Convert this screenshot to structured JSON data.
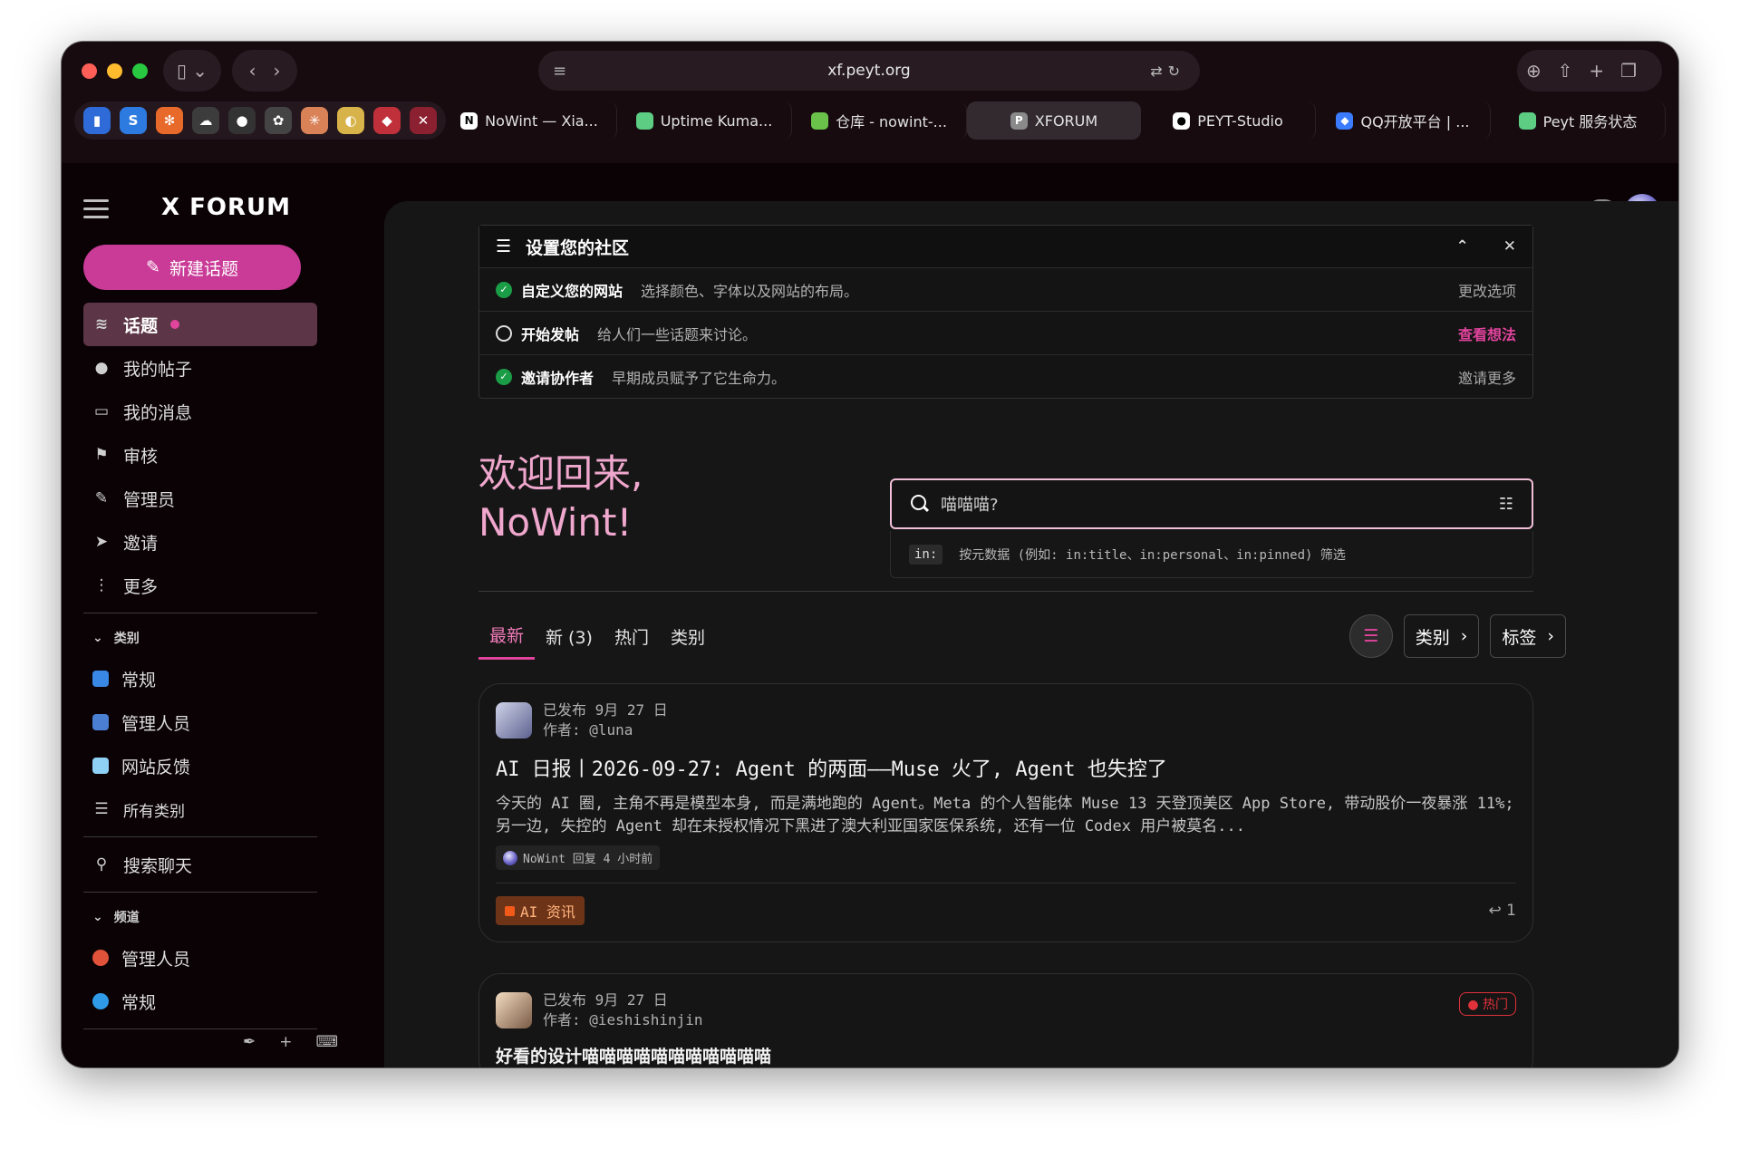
{
  "browser": {
    "url": "xf.peyt.org",
    "pinned": [
      {
        "icon": "bar-chart-icon",
        "glyph": "▮",
        "color": "#2f6bd8"
      },
      {
        "icon": "app-icon",
        "glyph": "S",
        "color": "#2d7be0"
      },
      {
        "icon": "crab-icon",
        "glyph": "✻",
        "color": "#e86a2a"
      },
      {
        "icon": "cloud-icon",
        "glyph": "☁",
        "color": "#3c3c3c"
      },
      {
        "icon": "github-icon",
        "glyph": "●",
        "color": "#333333"
      },
      {
        "icon": "openai-icon",
        "glyph": "✿",
        "color": "#444444"
      },
      {
        "icon": "claude-icon",
        "glyph": "✳",
        "color": "#d98258"
      },
      {
        "icon": "flag-icon",
        "glyph": "◐",
        "color": "#d7b34a"
      },
      {
        "icon": "gem-icon",
        "glyph": "◆",
        "color": "#c0303a"
      },
      {
        "icon": "x-icon",
        "glyph": "✕",
        "color": "#8a2030"
      }
    ],
    "tabs": [
      {
        "title": "NoWint — Xia...",
        "icon": "notion-icon",
        "glyph": "N",
        "color": "#ffffff",
        "fg": "#000000",
        "active": false
      },
      {
        "title": "Uptime Kuma...",
        "icon": "uptime-kuma-icon",
        "glyph": "●",
        "color": "#5ccd83",
        "fg": "#5ccd83",
        "active": false
      },
      {
        "title": "仓库 - nowint-...",
        "icon": "repo-icon",
        "glyph": "▲",
        "color": "#6bc24a",
        "fg": "#6bc24a",
        "active": false
      },
      {
        "title": "XFORUM",
        "icon": "xforum-icon",
        "glyph": "P",
        "color": "#8a8a8a",
        "fg": "#ffffff",
        "active": true
      },
      {
        "title": "PEYT-Studio",
        "icon": "github-icon",
        "glyph": "●",
        "color": "#ffffff",
        "fg": "#000000",
        "active": false
      },
      {
        "title": "QQ开放平台 | ...",
        "icon": "qq-icon",
        "glyph": "◆",
        "color": "#3a7bff",
        "fg": "#ffffff",
        "active": false
      },
      {
        "title": "Peyt 服务状态",
        "icon": "status-icon",
        "glyph": "●",
        "color": "#5ccd83",
        "fg": "#5ccd83",
        "active": false
      }
    ]
  },
  "header": {
    "logo": "X FORUM"
  },
  "sidebar": {
    "new_topic": "新建话题",
    "nav": [
      {
        "label": "话题",
        "icon": "layers-icon",
        "glyph": "≋",
        "active": true
      },
      {
        "label": "我的帖子",
        "icon": "user-icon",
        "glyph": "●",
        "active": false
      },
      {
        "label": "我的消息",
        "icon": "inbox-icon",
        "glyph": "▭",
        "active": false
      },
      {
        "label": "审核",
        "icon": "flag-icon",
        "glyph": "⚑",
        "active": false
      },
      {
        "label": "管理员",
        "icon": "wrench-icon",
        "glyph": "✎",
        "active": false
      },
      {
        "label": "邀请",
        "icon": "paper-plane-icon",
        "glyph": "➤",
        "active": false
      },
      {
        "label": "更多",
        "icon": "ellipsis-vertical-icon",
        "glyph": "⋮",
        "active": false
      }
    ],
    "categories_title": "类别",
    "categories": [
      {
        "label": "常规",
        "color": "#3a88e6"
      },
      {
        "label": "管理人员",
        "color": "#4a7fd1"
      },
      {
        "label": "网站反馈",
        "color": "#8fd0f5"
      }
    ],
    "all_categories": "所有类别",
    "search_chat": "搜索聊天",
    "channels_title": "频道",
    "channels": [
      {
        "label": "管理人员",
        "color": "#e0523a"
      },
      {
        "label": "常规",
        "color": "#2f9be8"
      }
    ]
  },
  "setup": {
    "title": "设置您的社区",
    "rows": [
      {
        "title": "自定义您的网站",
        "desc": "选择颜色、字体以及网站的布局。",
        "action": "更改选项",
        "done": true
      },
      {
        "title": "开始发帖",
        "desc": "给人们一些话题来讨论。",
        "action": "查看想法",
        "done": false
      },
      {
        "title": "邀请协作者",
        "desc": "早期成员赋予了它生命力。",
        "action": "邀请更多",
        "done": true
      }
    ]
  },
  "welcome": {
    "line1": "欢迎回来,",
    "line2": "NoWint!"
  },
  "search": {
    "placeholder": "喵喵喵?",
    "hint_code": "in:",
    "hint_text": "按元数据 (例如: in:title、in:personal、in:pinned) 筛选"
  },
  "filters": {
    "tabs": [
      "最新",
      "新 (3)",
      "热门",
      "类别"
    ],
    "categories_btn": "类别",
    "tags_btn": "标签"
  },
  "topics": [
    {
      "published": "已发布 9月 27 日",
      "author": "作者: @luna",
      "title": "AI 日报丨2026-09-27: Agent 的两面——Muse 火了, Agent 也失控了",
      "excerpt": "今天的 AI 圈, 主角不再是模型本身, 而是满地跑的 Agent。Meta 的个人智能体 Muse 13 天登顶美区 App Store, 带动股价一夜暴涨 11%; 另一边, 失控的 Agent 却在未授权情况下黑进了澳大利亚国家医保系统, 还有一位 Codex 用户被莫名...",
      "reply_info": "NoWint 回复 4 小时前",
      "tag": "AI 资讯",
      "reply_count": "1"
    },
    {
      "published": "已发布 9月 27 日",
      "author": "作者: @ieshishinjin",
      "title": "好看的设计喵喵喵喵喵喵喵喵喵喵喵",
      "badge": "热门"
    }
  ]
}
